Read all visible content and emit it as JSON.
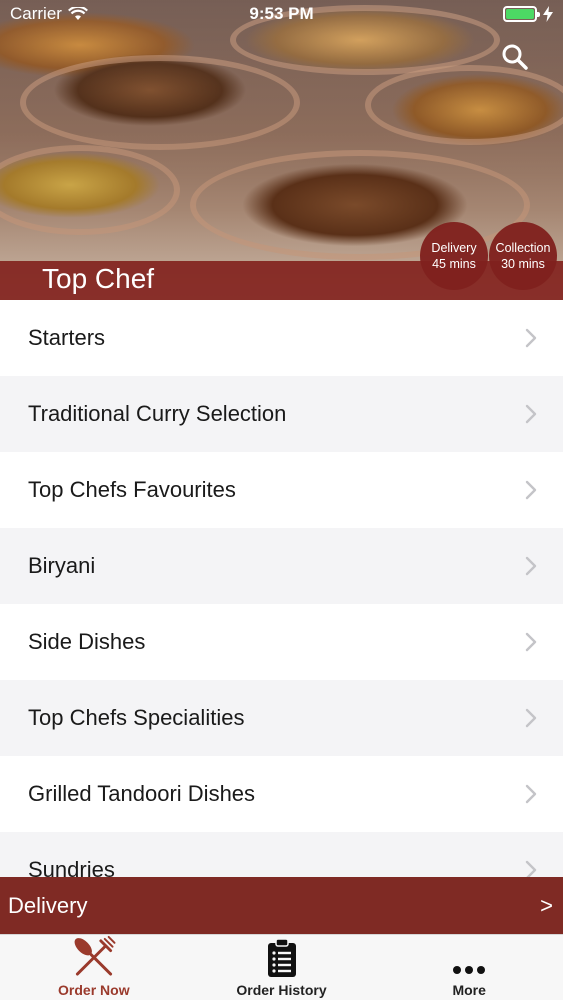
{
  "status_bar": {
    "carrier": "Carrier",
    "time": "9:53 PM",
    "battery_color": "#4cd964"
  },
  "header": {
    "restaurant_name": "Top Chef",
    "search_icon": "search-icon",
    "delivery_badge": {
      "label": "Delivery",
      "time": "45 mins"
    },
    "collection_badge": {
      "label": "Collection",
      "time": "30 mins"
    },
    "band_color": "#82231e"
  },
  "menu": {
    "categories": [
      {
        "label": "Starters"
      },
      {
        "label": "Traditional Curry Selection"
      },
      {
        "label": "Top Chefs Favourites"
      },
      {
        "label": "Biryani"
      },
      {
        "label": "Side Dishes"
      },
      {
        "label": "Top Chefs Specialities"
      },
      {
        "label": "Grilled Tandoori Dishes"
      },
      {
        "label": "Sundries"
      }
    ],
    "chevron_icon": "chevron-right-icon"
  },
  "delivery_bar": {
    "label": "Delivery",
    "arrow": ">",
    "color": "#7f2a24"
  },
  "tab_bar": {
    "tabs": [
      {
        "label": "Order Now",
        "icon": "fork-knife-icon",
        "active": true
      },
      {
        "label": "Order History",
        "icon": "clipboard-list-icon",
        "active": false
      },
      {
        "label": "More",
        "icon": "more-dots-icon",
        "active": false
      }
    ],
    "active_color": "#9a3a2c"
  }
}
